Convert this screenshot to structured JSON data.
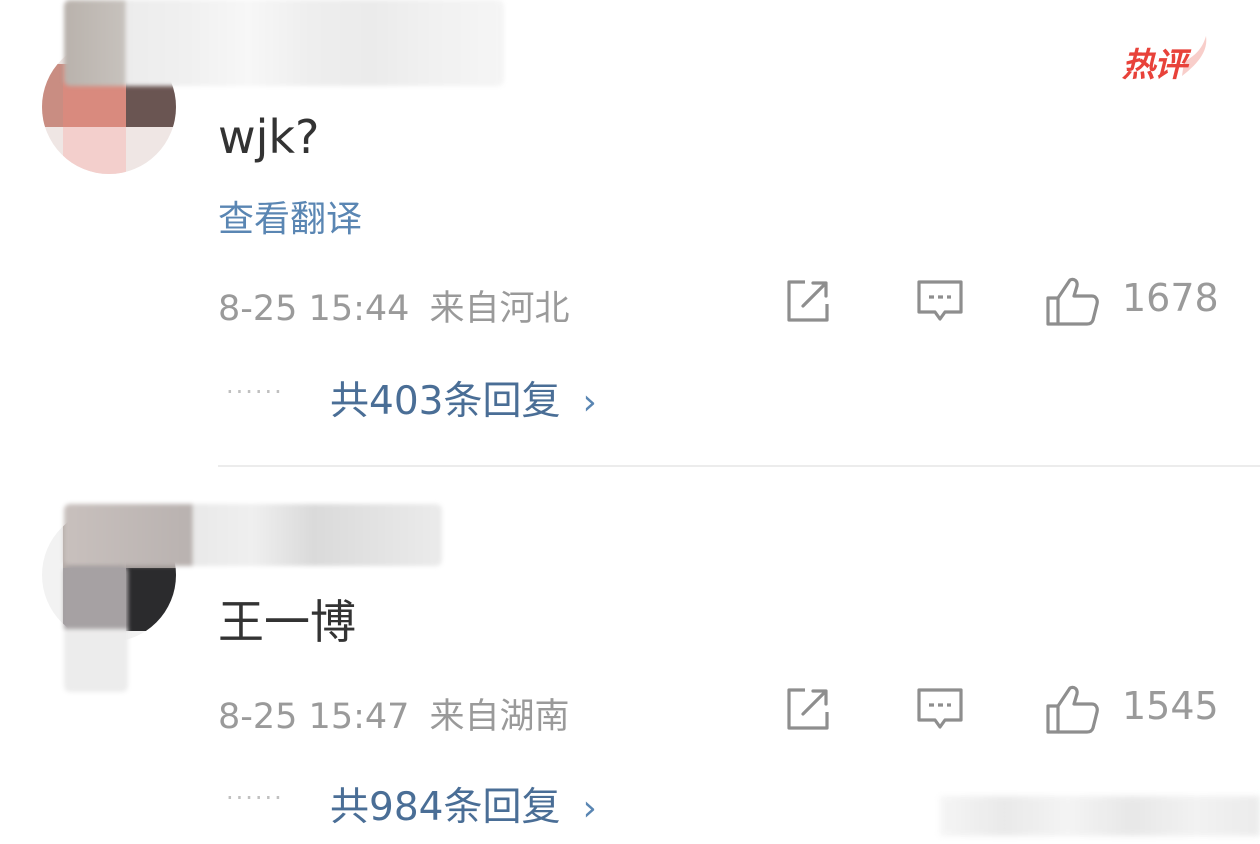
{
  "comments": [
    {
      "text": "wjk?",
      "translate_label": "查看翻译",
      "time": "8-25 15:44",
      "location": "来自河北",
      "likes": "1678",
      "dots": "······",
      "replies_label": "共403条回复",
      "hot_badge": "热评"
    },
    {
      "text": "王一博",
      "time": "8-25 15:47",
      "location": "来自湖南",
      "likes": "1545",
      "dots": "······",
      "replies_label": "共984条回复"
    }
  ],
  "icons": {
    "share": "share-icon",
    "comment": "comment-icon",
    "like": "thumbs-up-icon",
    "chevron": "chevron-right-icon"
  },
  "colors": {
    "link": "#5a86b3",
    "reply_link": "#4a6e96",
    "meta": "#9a9a9a",
    "text": "#333333",
    "hot_badge": "#e8423a"
  }
}
